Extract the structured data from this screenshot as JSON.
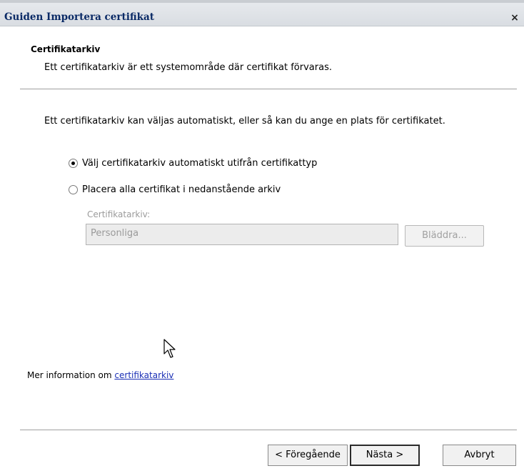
{
  "window": {
    "title": "Guiden Importera certifikat",
    "close_label": "×"
  },
  "header": {
    "title": "Certifikatarkiv",
    "subtitle": "Ett certifikatarkiv är ett systemområde där certifikat förvaras."
  },
  "body": {
    "intro": "Ett certifikatarkiv kan väljas automatiskt, eller så kan du ange en plats för certifikatet.",
    "options": [
      {
        "label": "Välj certifikatarkiv automatiskt utifrån certifikattyp",
        "checked": true
      },
      {
        "label": "Placera alla certifikat i nedanstående arkiv",
        "checked": false
      }
    ],
    "store_label": "Certifikatarkiv:",
    "store_value": "Personliga",
    "browse_label": "Bläddra..."
  },
  "more_info": {
    "prefix": "Mer information om ",
    "link": "certifikatarkiv"
  },
  "buttons": {
    "back": "< Föregående",
    "next": "Nästa >",
    "cancel": "Avbryt"
  }
}
